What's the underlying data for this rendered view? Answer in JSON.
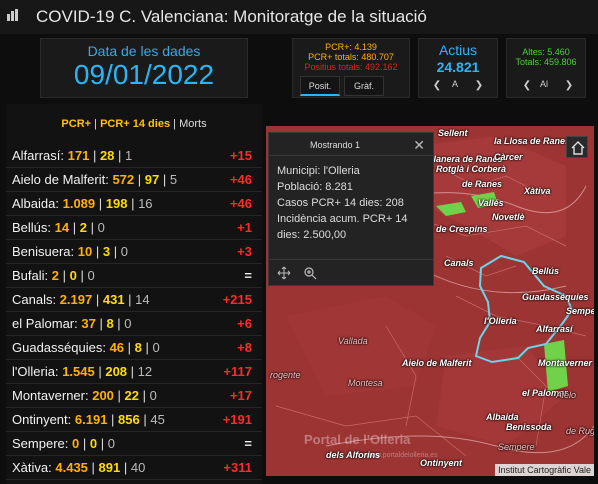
{
  "header": {
    "title": "COVID-19 C. Valenciana: Monitoratge de la situació",
    "app_icon": "chart-icon"
  },
  "date_panel": {
    "label": "Data de les dades",
    "value": "09/01/2022"
  },
  "pcr_panel": {
    "pcr": "PCR+: 4.139",
    "pcr_totals": "PCR+ totals: 480.707",
    "positius_totals": "Positius totals: 492.162"
  },
  "tabs": {
    "posit": "Posit.",
    "graf": "Gràf."
  },
  "actius": {
    "label": "Actius",
    "value": "24.821",
    "nav_label": "A"
  },
  "altes": {
    "altes": "Altes: 5.460",
    "totals": "Totals: 459.806",
    "nav_label": "Al"
  },
  "list": {
    "head_pcr": "PCR+",
    "head_sep1": " | ",
    "head_pcr14": "PCR+ 14 dies",
    "head_sep2": " | ",
    "head_morts": "Morts",
    "rows": [
      {
        "name": "Alfarrasí:",
        "pcr": "171",
        "p14": "28",
        "morts": "1",
        "delta": "+15"
      },
      {
        "name": "Aielo de Malferit:",
        "pcr": "572",
        "p14": "97",
        "morts": "5",
        "delta": "+46"
      },
      {
        "name": "Albaida:",
        "pcr": "1.089",
        "p14": "198",
        "morts": "16",
        "delta": "+46"
      },
      {
        "name": "Bellús:",
        "pcr": "14",
        "p14": "2",
        "morts": "0",
        "delta": "+1"
      },
      {
        "name": "Benisuera:",
        "pcr": "10",
        "p14": "3",
        "morts": "0",
        "delta": "+3"
      },
      {
        "name": "Bufali:",
        "pcr": "2",
        "p14": "0",
        "morts": "0",
        "delta": "="
      },
      {
        "name": "Canals:",
        "pcr": "2.197",
        "p14": "431",
        "morts": "14",
        "delta": "+215"
      },
      {
        "name": "el Palomar:",
        "pcr": "37",
        "p14": "8",
        "morts": "0",
        "delta": "+6"
      },
      {
        "name": "Guadasséquies:",
        "pcr": "46",
        "p14": "8",
        "morts": "0",
        "delta": "+8"
      },
      {
        "name": "l'Olleria:",
        "pcr": "1.545",
        "p14": "208",
        "morts": "12",
        "delta": "+117"
      },
      {
        "name": "Montaverner:",
        "pcr": "200",
        "p14": "22",
        "morts": "0",
        "delta": "+17"
      },
      {
        "name": "Ontinyent:",
        "pcr": "6.191",
        "p14": "856",
        "morts": "45",
        "delta": "+191"
      },
      {
        "name": "Sempere:",
        "pcr": "0",
        "p14": "0",
        "morts": "0",
        "delta": "="
      },
      {
        "name": "Xàtiva:",
        "pcr": "4.435",
        "p14": "891",
        "morts": "40",
        "delta": "+311"
      }
    ]
  },
  "popup": {
    "title": "Mostrando 1",
    "municipi": "Municipi: l'Olleria",
    "poblacio": "Població: 8.281",
    "casos": "Casos PCR+ 14 dies: 208",
    "incidencia": "Incidència acum. PCR+ 14 dies: 2.500,00"
  },
  "map": {
    "places": [
      "Sellent",
      "la Llosa de Ranes",
      "Llanera de Ranes",
      "Càrcer",
      "Rotglà i Corberà",
      "de Ranes",
      "Xàtiva",
      "Vallés",
      "Novetlè",
      "de Crespins",
      "Canals",
      "Bellús",
      "Guadasséquies",
      "Sempe",
      "l'Olleria",
      "Alfarrasí",
      "Vallada",
      "Aielo de Malferit",
      "Montaverner",
      "el Palomar",
      "Albaida",
      "Ontinyent",
      "Benissoda",
      "Aielo",
      "de Rugat",
      "Montesa",
      "rogente",
      "Sempere",
      "dels Alforins"
    ],
    "watermark": "Portal de l'Olleria",
    "watermark_sub": "www.portaldelolleria.es",
    "attribution": "Institut Cartogràfic Vale"
  },
  "colors": {
    "accent_blue": "#29b6f6",
    "pcr_orange": "#ffb100",
    "delta_red": "#ff2a2a",
    "green": "#4cd137",
    "map_red": "#9c3434"
  }
}
